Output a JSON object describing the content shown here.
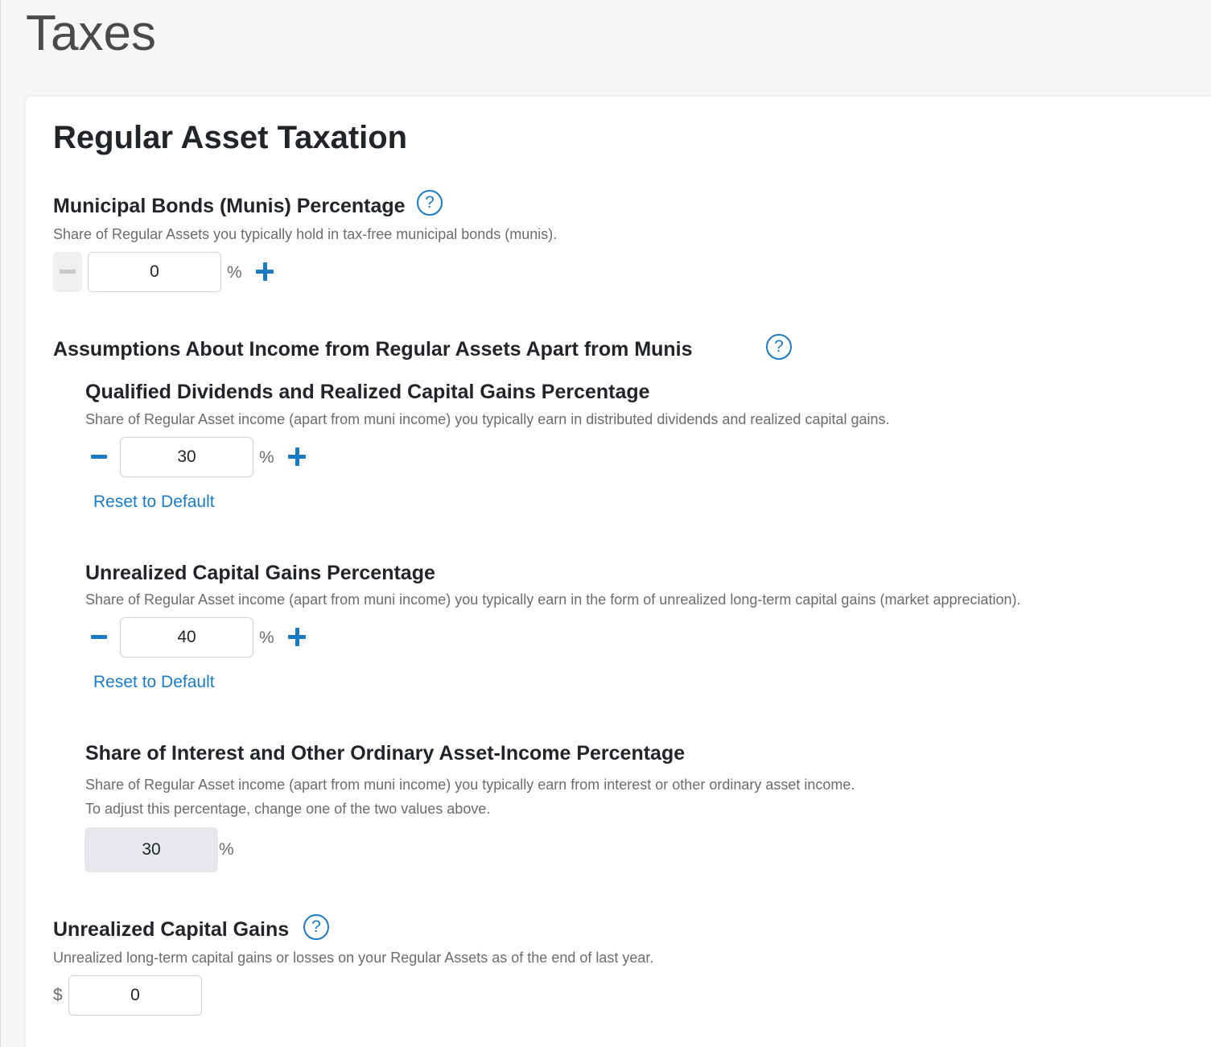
{
  "page": {
    "title": "Taxes"
  },
  "card": {
    "title": "Regular Asset Taxation"
  },
  "munis": {
    "label": "Municipal Bonds (Munis) Percentage",
    "help": "?",
    "description": "Share of Regular Assets you typically hold in tax-free municipal bonds (munis).",
    "value": "0",
    "unit": "%"
  },
  "assumptions": {
    "label": "Assumptions About Income from Regular Assets Apart from Munis",
    "help": "?",
    "qualified": {
      "label": "Qualified Dividends and Realized Capital Gains Percentage",
      "description": "Share of Regular Asset income (apart from muni income) you typically earn in distributed dividends and realized capital gains.",
      "value": "30",
      "unit": "%",
      "reset": "Reset to Default"
    },
    "unrealized_pct": {
      "label": "Unrealized Capital Gains Percentage",
      "description": "Share of Regular Asset income (apart from muni income) you typically earn in the form of unrealized long-term capital gains (market appreciation).",
      "value": "40",
      "unit": "%",
      "reset": "Reset to Default"
    },
    "interest": {
      "label": "Share of Interest and Other Ordinary Asset-Income Percentage",
      "description_1": "Share of Regular Asset income (apart from muni income) you typically earn from interest or other ordinary asset income.",
      "description_2": "To adjust this percentage, change one of the two values above.",
      "value": "30",
      "unit": "%"
    }
  },
  "unrealized_gains": {
    "label": "Unrealized Capital Gains",
    "help": "?",
    "description": "Unrealized long-term capital gains or losses on your Regular Assets as of the end of last year.",
    "currency": "$",
    "value": "0"
  },
  "colors": {
    "accent": "#1a7bc4",
    "muted_text": "#6c6c6c",
    "readonly_bg": "#e6e8eb"
  }
}
